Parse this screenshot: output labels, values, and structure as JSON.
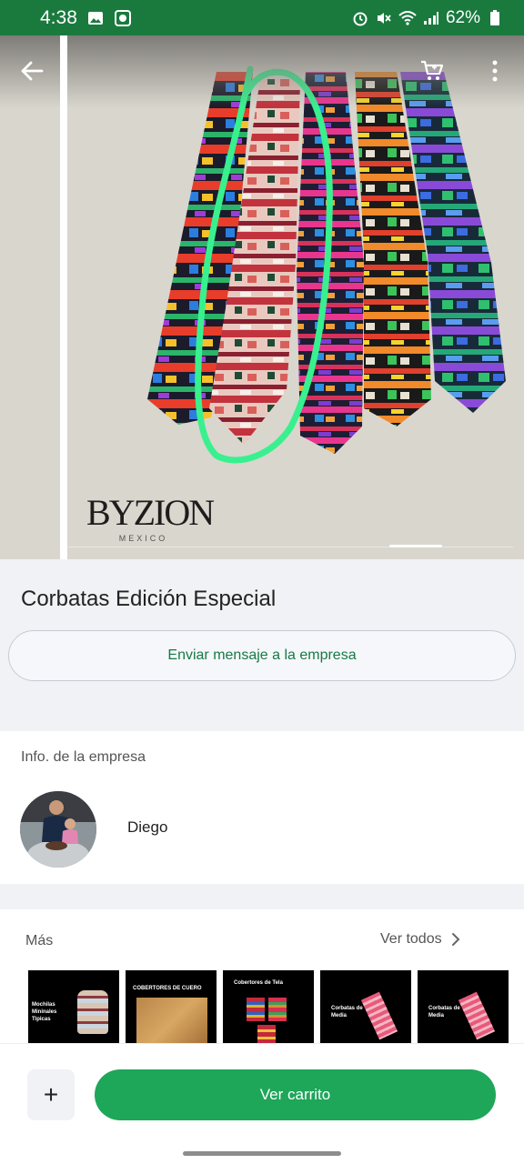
{
  "status_bar": {
    "time": "4:38",
    "battery": "62%",
    "icons": [
      "gallery-icon",
      "app-icon",
      "alarm-icon",
      "mute-icon",
      "wifi-icon",
      "signal-icon",
      "battery-icon"
    ]
  },
  "header": {
    "back_icon": "arrow-left-icon",
    "cart_icon": "shopping-cart-icon",
    "menu_icon": "more-vertical-icon"
  },
  "hero": {
    "brand_name": "BYZION",
    "brand_sub": "MEXICO"
  },
  "product": {
    "title": "Corbatas Edición Especial",
    "message_button": "Enviar mensaje a la empresa"
  },
  "company": {
    "section_label": "Info. de la empresa",
    "owner_name": "Diego"
  },
  "more": {
    "section_label": "Más",
    "see_all": "Ver todos",
    "thumbnails": [
      {
        "title": "Mochilas Mininales Tipicas"
      },
      {
        "title": "COBERTORES DE CUERO"
      },
      {
        "title": "Cobertores de Tela"
      },
      {
        "title": "Corbatas de Media"
      },
      {
        "title": "Corbatas de Media"
      }
    ]
  },
  "bottom": {
    "plus_label": "+",
    "cart_button": "Ver carrito"
  },
  "colors": {
    "status_bar": "#1a7a3e",
    "accent_green": "#1ea659",
    "link_green": "#157a45",
    "highlight_stroke": "#39f08f"
  }
}
